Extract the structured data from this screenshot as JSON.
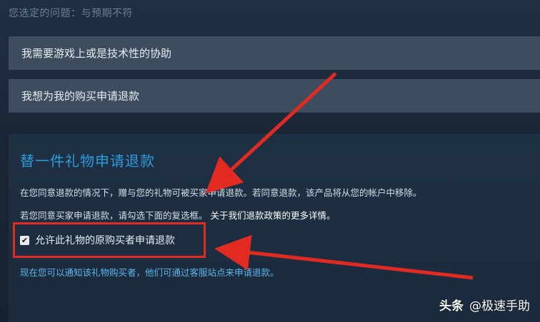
{
  "selected_issue": "您选定的问题：与预期不符",
  "options": [
    {
      "label": "我需要游戏上或是技术性的协助"
    },
    {
      "label": "我想为我的购买申请退款"
    }
  ],
  "gift_refund": {
    "title": "替一件礼物申请退款",
    "line1": "在您同意退款的情况下，赠与您的礼物可被买家申请退款。若同意退款，该产品将从您的帐户中移除。",
    "line2_text": "若您同意买家申请退款，请勾选下面的复选框。",
    "line2_link": "关于我们退款政策的更多详情。",
    "checkbox_label": "允许此礼物的原购买者申请退款",
    "checkbox_checked": true,
    "notice": "现在您可以通知该礼物购买者，他们可通过客服站点来申请退款。"
  },
  "watermark": {
    "source": "头条",
    "author": "@极速手助"
  },
  "colors": {
    "background": "#1b2838",
    "option_row": "#3d4d5e",
    "title_blue": "#2d9bd8",
    "notice_blue": "#5fb4ea",
    "annotation_red": "#e02a22"
  }
}
